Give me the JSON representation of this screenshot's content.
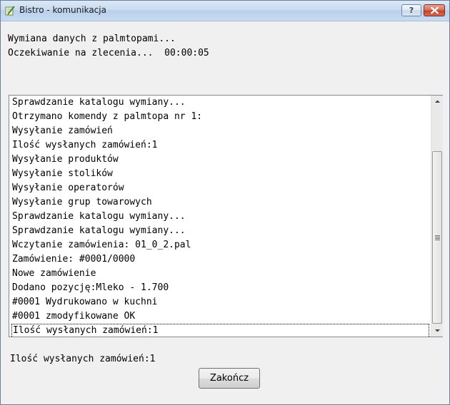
{
  "window": {
    "title": "Bistro - komunikacja",
    "help_label": "?"
  },
  "status": {
    "line1": "Wymiana danych z palmtopami...",
    "line2": "Oczekiwanie na zlecenia...  00:00:05"
  },
  "log": {
    "items": [
      "Sprawdzanie katalogu wymiany...",
      "Otrzymano komendy z palmtopa nr 1:",
      "Wysyłanie zamówień",
      "Ilość wysłanych zamówień:1",
      "Wysyłanie produktów",
      "Wysyłanie stolików",
      "Wysyłanie operatorów",
      "Wysyłanie grup towarowych",
      "Sprawdzanie katalogu wymiany...",
      "Sprawdzanie katalogu wymiany...",
      "Wczytanie zamówienia: 01_0_2.pal",
      "Zamówienie: #0001/0000",
      "Nowe zamówienie",
      "Dodano pozycję:Mleko - 1.700",
      "#0001 Wydrukowano w kuchni",
      "#0001 zmodyfikowane OK",
      "Ilość wysłanych zamówień:1"
    ],
    "selected_index": 16
  },
  "footer": {
    "summary": "Ilość wysłanych zamówień:1",
    "end_button": "Zakończ"
  },
  "colors": {
    "close_button": "#c5432c",
    "title_bar": "#c9dcf1"
  },
  "icons": {
    "app": "pencil-notepad-icon",
    "close": "close-icon",
    "help": "help-icon"
  }
}
